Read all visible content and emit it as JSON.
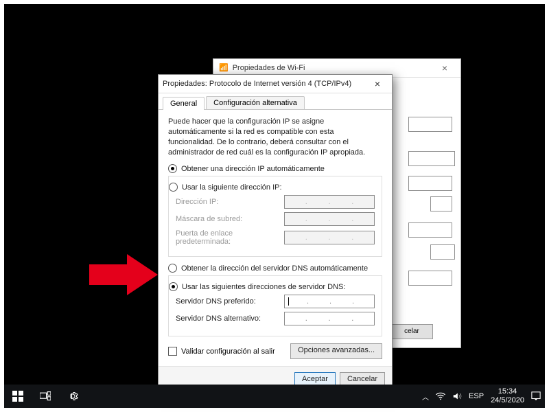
{
  "back_window": {
    "title": "Propiedades de Wi-Fi",
    "button": "celar"
  },
  "dialog": {
    "title": "Propiedades: Protocolo de Internet versión 4 (TCP/IPv4)",
    "tabs": {
      "general": "General",
      "alt": "Configuración alternativa"
    },
    "intro": "Puede hacer que la configuración IP se asigne automáticamente si la red es compatible con esta funcionalidad. De lo contrario, deberá consultar con el administrador de red cuál es la configuración IP apropiada.",
    "ip": {
      "auto": "Obtener una dirección IP automáticamente",
      "manual": "Usar la siguiente dirección IP:",
      "addr": "Dirección IP:",
      "mask": "Máscara de subred:",
      "gw": "Puerta de enlace predeterminada:"
    },
    "dns": {
      "auto": "Obtener la dirección del servidor DNS automáticamente",
      "manual": "Usar las siguientes direcciones de servidor DNS:",
      "pref": "Servidor DNS preferido:",
      "alt": "Servidor DNS alternativo:"
    },
    "validate": "Validar configuración al salir",
    "advanced": "Opciones avanzadas...",
    "ok": "Aceptar",
    "cancel": "Cancelar"
  },
  "taskbar": {
    "lang": "ESP",
    "time": "15:34",
    "date": "24/5/2020"
  }
}
